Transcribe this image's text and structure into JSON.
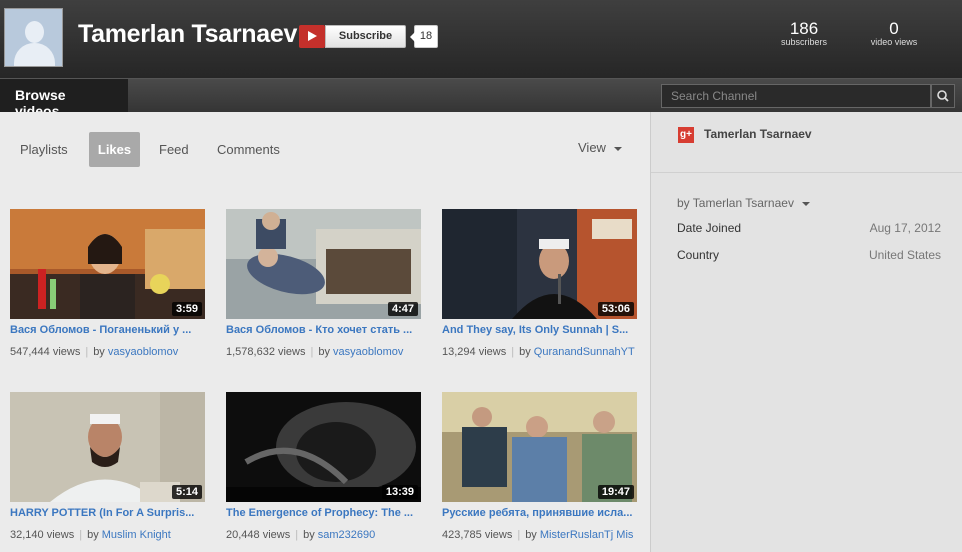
{
  "header": {
    "channel_name": "Tamerlan Tsarnaev",
    "subscribe_label": "Subscribe",
    "subscribe_count": "18",
    "stats": [
      {
        "value": "186",
        "label": "subscribers"
      },
      {
        "value": "0",
        "label": "video views"
      }
    ]
  },
  "nav": {
    "browse_label": "Browse videos",
    "search_placeholder": "Search Channel"
  },
  "tabs": [
    {
      "label": "Playlists",
      "active": false
    },
    {
      "label": "Likes",
      "active": true
    },
    {
      "label": "Feed",
      "active": false
    },
    {
      "label": "Comments",
      "active": false
    }
  ],
  "view_label": "View",
  "videos": [
    {
      "title": "Вася Обломов - Поганенький у ...",
      "duration": "3:59",
      "views": "547,444 views",
      "by": "by",
      "author": "vasyaoblomov"
    },
    {
      "title": "Вася Обломов - Кто хочет стать ...",
      "duration": "4:47",
      "views": "1,578,632 views",
      "by": "by",
      "author": "vasyaoblomov"
    },
    {
      "title": "And They say, Its Only Sunnah | S...",
      "duration": "53:06",
      "views": "13,294 views",
      "by": "by",
      "author": "QuranandSunnahYT"
    },
    {
      "title": "HARRY POTTER (In For A Surpris...",
      "duration": "5:14",
      "views": "32,140 views",
      "by": "by",
      "author": "Muslim Knight"
    },
    {
      "title": "The Emergence of Prophecy: The ...",
      "duration": "13:39",
      "views": "20,448 views",
      "by": "by",
      "author": "sam232690"
    },
    {
      "title": "Русские ребята, принявшие исла...",
      "duration": "19:47",
      "views": "423,785 views",
      "by": "by",
      "author": "MisterRuslanTj Mis"
    }
  ],
  "sidebar": {
    "gplus_label": "g+",
    "name": "Tamerlan Tsarnaev",
    "by_label": "by Tamerlan Tsarnaev",
    "rows": [
      {
        "key": "Date Joined",
        "value": "Aug 17, 2012"
      },
      {
        "key": "Country",
        "value": "United States"
      }
    ]
  }
}
